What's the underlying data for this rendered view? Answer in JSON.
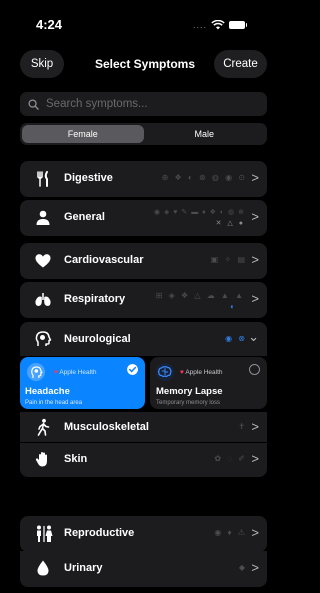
{
  "status": {
    "time": "4:24",
    "dots": "...."
  },
  "nav": {
    "skip": "Skip",
    "title": "Select Symptoms",
    "create": "Create"
  },
  "search": {
    "placeholder": "Search symptoms..."
  },
  "segments": [
    {
      "label": "Female",
      "selected": true
    },
    {
      "label": "Male",
      "selected": false
    }
  ],
  "categories": [
    {
      "label": "Digestive",
      "icon": "fork-knife-icon",
      "mini": "⊕ ❖ ◐ ⊗ ◍ ◉ ⊙",
      "chevron": ">"
    },
    {
      "label": "General",
      "icon": "person-icon",
      "mini": "◉ ◈ ♥ ✎ ▬ ♦ ❖ ◐ ◍ ⊕",
      "mini2": "✕ △ ●",
      "chevron": ">"
    },
    {
      "label": "Cardiovascular",
      "icon": "heart-icon",
      "mini": "▣ ✧ ▤",
      "chevron": ">"
    },
    {
      "label": "Respiratory",
      "icon": "lungs-icon",
      "mini": "⊞ ◈ ❖ △ ☁ ▲ ▲",
      "mini2": "◐",
      "chevron": ">"
    },
    {
      "label": "Neurological",
      "icon": "brain-icon",
      "mini": "◉ ⊗",
      "chevron": "⌄"
    },
    {
      "label": "Musculoskeletal",
      "icon": "figure-walk-icon",
      "mini": "✝",
      "chevron": ">"
    },
    {
      "label": "Skin",
      "icon": "hand-icon",
      "mini": "✿ ◌ ✐",
      "chevron": ">"
    },
    {
      "label": "Reproductive",
      "icon": "people-icon",
      "mini": "◉ ♦ ⚠",
      "chevron": ">"
    },
    {
      "label": "Urinary",
      "icon": "drop-icon",
      "mini": "◆",
      "chevron": ">"
    }
  ],
  "neurological_items": [
    {
      "title": "Headache",
      "subtitle": "Pain in the head area",
      "source": "Apple Health",
      "selected": true,
      "icon": "head-profile-icon"
    },
    {
      "title": "Memory Lapse",
      "subtitle": "Temporary memory loss",
      "source": "Apple Health",
      "selected": false,
      "icon": "brain-icon"
    }
  ],
  "colors": {
    "accent": "#0a84ff",
    "card": "#1c1c1e",
    "background": "#000000",
    "health_heart": "#ff375f"
  }
}
